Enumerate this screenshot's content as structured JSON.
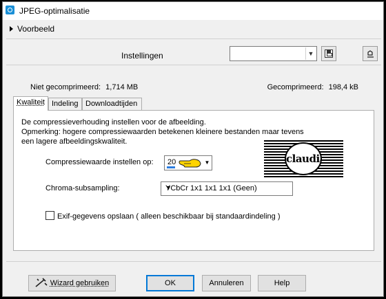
{
  "window": {
    "title": "JPEG-optimalisatie"
  },
  "preview": {
    "label": "Voorbeeld"
  },
  "settings": {
    "label": "Instellingen",
    "preset_value": ""
  },
  "info": {
    "uncompressed_label": "Niet gecomprimeerd:",
    "uncompressed_value": "1,714 MB",
    "compressed_label": "Gecomprimeerd:",
    "compressed_value": "198,4 kB"
  },
  "tabs": [
    {
      "label": "Kwaliteit"
    },
    {
      "label": "Indeling"
    },
    {
      "label": "Downloadtijden"
    }
  ],
  "quality": {
    "description": "De compressieverhouding instellen voor de afbeelding.",
    "note": "Opmerking:  hogere compressiewaarden betekenen kleinere bestanden maar tevens een lagere afbeeldingskwaliteit.",
    "compression_label": "Compressiewaarde instellen op:",
    "compression_value": "20",
    "chroma_label": "Chroma-subsampling:",
    "chroma_value": "YCbCr  1x1  1x1  1x1  (Geen)",
    "exif_label": "Exif-gegevens opslaan ( alleen beschikbaar bij standaardindeling )",
    "exif_checked": false
  },
  "logo": {
    "text": "claudia"
  },
  "buttons": {
    "wizard": "Wizard gebruiken",
    "ok": "OK",
    "cancel": "Annuleren",
    "help": "Help"
  },
  "colors": {
    "accent": "#0078d7",
    "slider_fill": "#2b7de0"
  }
}
